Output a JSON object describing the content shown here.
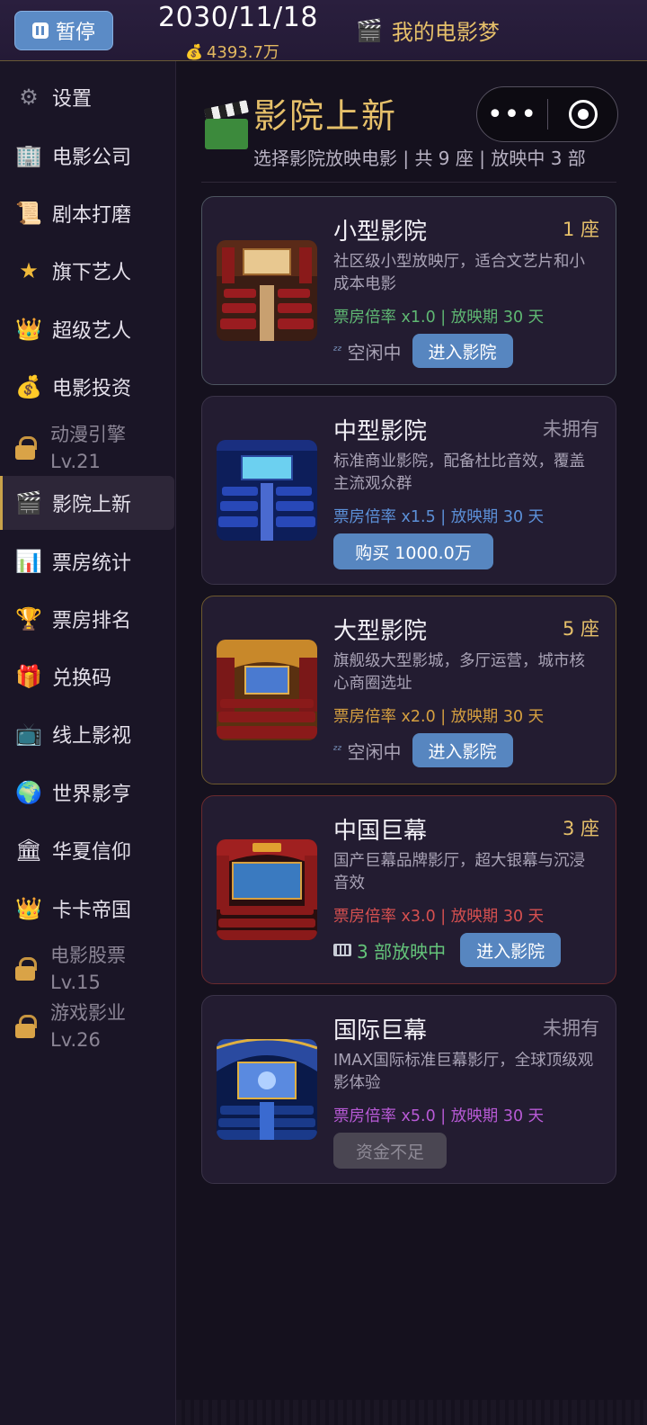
{
  "topbar": {
    "pause_label": "暂停",
    "date": "2030/11/18",
    "money": "4393.7万",
    "app_title": "我的电影梦"
  },
  "sidebar": {
    "items": [
      {
        "label": "设置",
        "icon": "gear-icon",
        "glyph": "⚙"
      },
      {
        "label": "电影公司",
        "icon": "building-icon",
        "glyph": "🏢"
      },
      {
        "label": "剧本打磨",
        "icon": "scroll-icon",
        "glyph": "📜"
      },
      {
        "label": "旗下艺人",
        "icon": "star-icon",
        "glyph": "⭐"
      },
      {
        "label": "超级艺人",
        "icon": "crown-icon",
        "glyph": "👑"
      },
      {
        "label": "电影投资",
        "icon": "money-bag-icon",
        "glyph": "💰"
      },
      {
        "label": "动漫引擎",
        "level": "Lv.21",
        "icon": "lock-icon",
        "locked": true
      },
      {
        "label": "影院上新",
        "icon": "clapper-icon",
        "glyph": "🎬",
        "active": true
      },
      {
        "label": "票房统计",
        "icon": "bar-chart-icon",
        "glyph": "📊"
      },
      {
        "label": "票房排名",
        "icon": "trophy-icon",
        "glyph": "🏆"
      },
      {
        "label": "兑换码",
        "icon": "gift-icon",
        "glyph": "🎁"
      },
      {
        "label": "线上影视",
        "icon": "tv-icon",
        "glyph": "📺"
      },
      {
        "label": "世界影亨",
        "icon": "globe-icon",
        "glyph": "🌍"
      },
      {
        "label": "华夏信仰",
        "icon": "temple-icon",
        "glyph": "🏛"
      },
      {
        "label": "卡卡帝国",
        "icon": "crown-icon",
        "glyph": "👑"
      },
      {
        "label": "电影股票",
        "level": "Lv.15",
        "icon": "lock-icon",
        "locked": true
      },
      {
        "label": "游戏影业",
        "level": "Lv.26",
        "icon": "lock-icon",
        "locked": true
      }
    ]
  },
  "main": {
    "title": "影院上新",
    "subtitle": "选择影院放映电影 | 共 9 座 | 放映中 3 部",
    "capsule": {
      "more": "•••"
    }
  },
  "cards": [
    {
      "name": "小型影院",
      "status": "1 座",
      "status_color": "#e6c06a",
      "desc": "社区级小型放映厅，适合文艺片和小成本电影",
      "rate": "票房倍率 x1.0 | 放映期 30 天",
      "rate_color": "#5fb873",
      "idle": "空闲中",
      "action": "进入影院"
    },
    {
      "name": "中型影院",
      "status": "未拥有",
      "status_color": "#9a94a6",
      "desc": "标准商业影院，配备杜比音效，覆盖主流观众群",
      "rate": "票房倍率 x1.5 | 放映期 30 天",
      "rate_color": "#5c90d8",
      "action": "购买 1000.0万"
    },
    {
      "name": "大型影院",
      "status": "5 座",
      "status_color": "#e6c06a",
      "desc": "旗舰级大型影城，多厅运营，城市核心商圈选址",
      "rate": "票房倍率 x2.0 | 放映期 30 天",
      "rate_color": "#d6a040",
      "idle": "空闲中",
      "action": "进入影院"
    },
    {
      "name": "中国巨幕",
      "status": "3 座",
      "status_color": "#e6c06a",
      "desc": "国产巨幕品牌影厅，超大银幕与沉浸音效",
      "rate": "票房倍率 x3.0 | 放映期 30 天",
      "rate_color": "#d65050",
      "showing": "3 部放映中",
      "action": "进入影院"
    },
    {
      "name": "国际巨幕",
      "status": "未拥有",
      "status_color": "#9a94a6",
      "desc": "IMAX国际标准巨幕影厅，全球顶级观影体验",
      "rate": "票房倍率 x5.0 | 放映期 30 天",
      "rate_color": "#b85ad6",
      "action": "资金不足"
    }
  ]
}
